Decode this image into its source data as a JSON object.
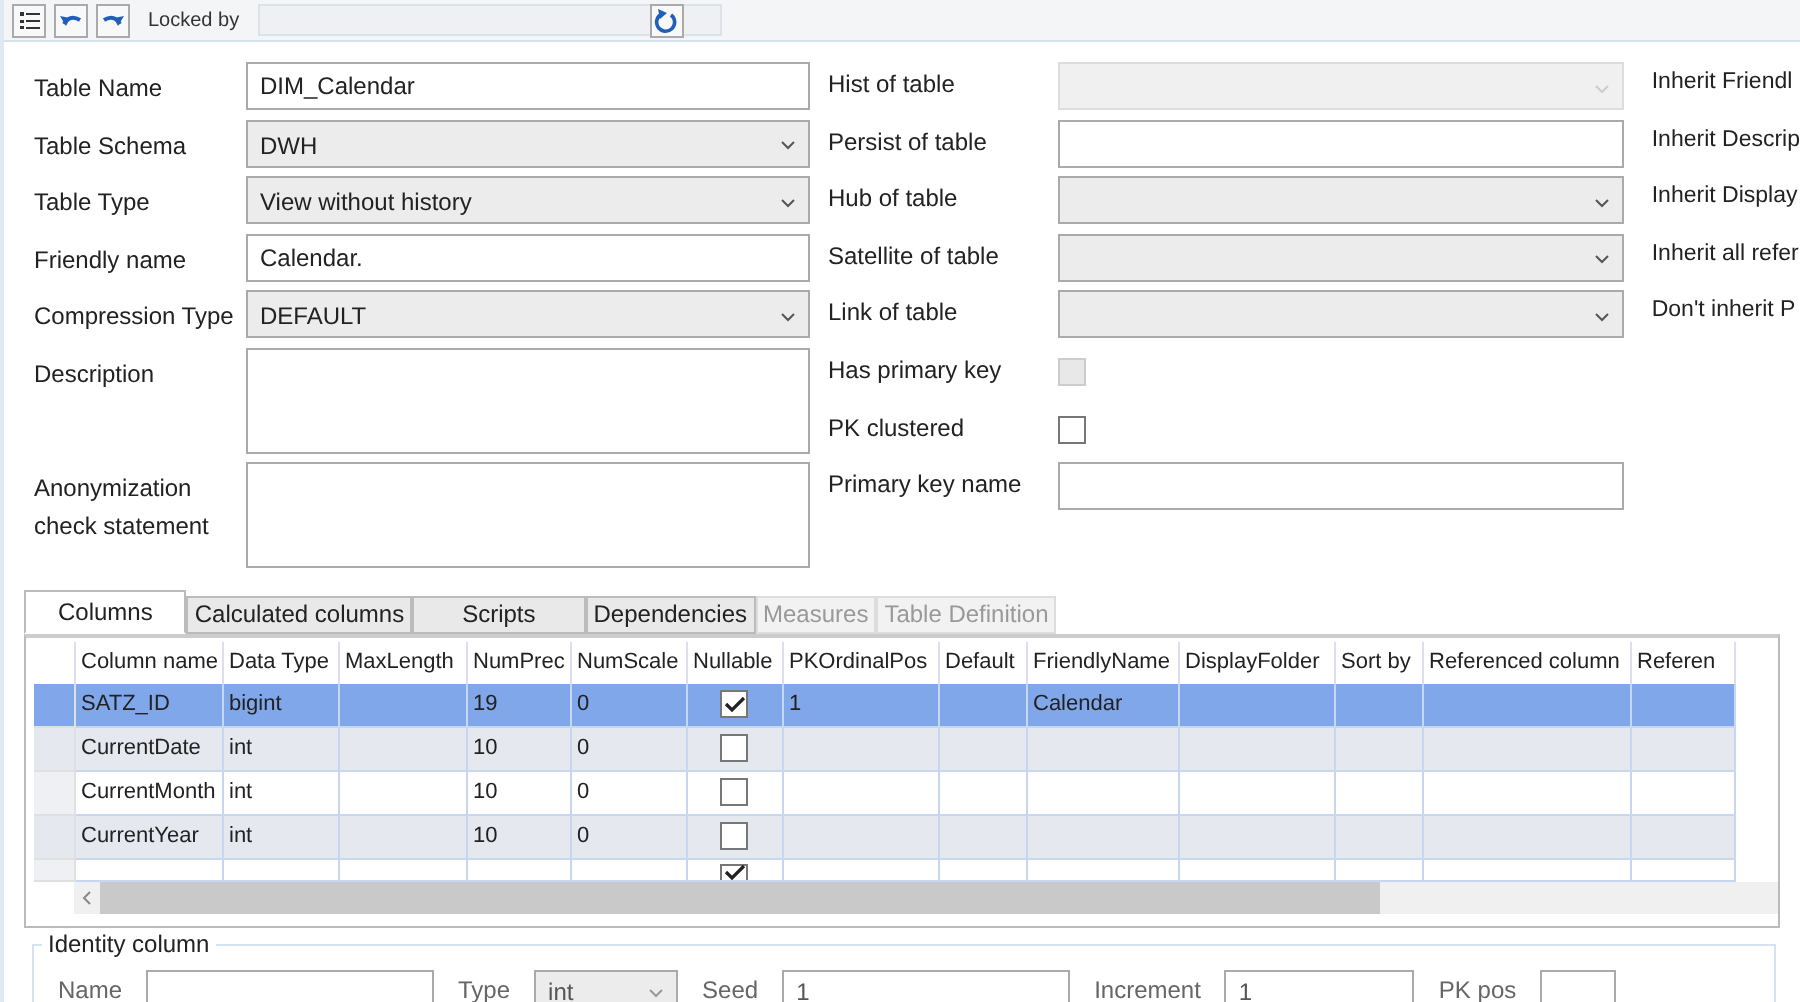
{
  "toolbar": {
    "locked_label": "Locked by"
  },
  "form_left": [
    {
      "label": "Table Name",
      "kind": "text",
      "value": "DIM_Calendar"
    },
    {
      "label": "Table Schema",
      "kind": "select",
      "value": "DWH"
    },
    {
      "label": "Table Type",
      "kind": "select",
      "value": "View without history"
    },
    {
      "label": "Friendly name",
      "kind": "text",
      "value": "Calendar."
    },
    {
      "label": "Compression Type",
      "kind": "select",
      "value": "DEFAULT"
    },
    {
      "label": "Description",
      "kind": "textarea"
    },
    {
      "label": "Anonymization check statement",
      "kind": "textarea"
    }
  ],
  "form_middle": [
    {
      "label": "Hist of table",
      "kind": "select",
      "disabled": true
    },
    {
      "label": "Persist of table",
      "kind": "text",
      "disabled": false
    },
    {
      "label": "Hub of table",
      "kind": "select",
      "disabled": false
    },
    {
      "label": "Satellite of table",
      "kind": "select",
      "disabled": false
    },
    {
      "label": "Link of table",
      "kind": "select",
      "disabled": false
    },
    {
      "label": "Has primary key",
      "kind": "checkbox",
      "checked": false,
      "disabled": true
    },
    {
      "label": "PK clustered",
      "kind": "checkbox",
      "checked": false,
      "disabled": false
    },
    {
      "label": "Primary key name",
      "kind": "text",
      "disabled": false
    }
  ],
  "form_right": [
    "Inherit Friendl",
    "Inherit Descrip",
    "Inherit Display",
    "Inherit all refer",
    "Don't inherit P"
  ],
  "tabs": [
    {
      "label": "Columns",
      "selected": true,
      "disabled": false
    },
    {
      "label": "Calculated columns",
      "selected": false,
      "disabled": false
    },
    {
      "label": "Scripts",
      "selected": false,
      "disabled": false
    },
    {
      "label": "Dependencies",
      "selected": false,
      "disabled": false
    },
    {
      "label": "Measures",
      "selected": false,
      "disabled": true
    },
    {
      "label": "Table Definition",
      "selected": false,
      "disabled": true
    }
  ],
  "table": {
    "columns": [
      "Column name",
      "Data Type",
      "MaxLength",
      "NumPrec",
      "NumScale",
      "Nullable",
      "PKOrdinalPos",
      "Default",
      "FriendlyName",
      "DisplayFolder",
      "Sort by",
      "Referenced column",
      "Referen"
    ],
    "rows": [
      {
        "selected": true,
        "cells": [
          "SATZ_ID",
          "bigint",
          "",
          "19",
          "0",
          "",
          "1",
          "",
          "Calendar",
          "",
          "",
          "",
          ""
        ],
        "nullable": true
      },
      {
        "selected": false,
        "cells": [
          "CurrentDate",
          "int",
          "",
          "10",
          "0",
          "",
          "",
          "",
          "",
          "",
          "",
          "",
          ""
        ],
        "nullable": false
      },
      {
        "selected": false,
        "cells": [
          "CurrentMonth",
          "int",
          "",
          "10",
          "0",
          "",
          "",
          "",
          "",
          "",
          "",
          "",
          ""
        ],
        "nullable": false
      },
      {
        "selected": false,
        "cells": [
          "CurrentYear",
          "int",
          "",
          "10",
          "0",
          "",
          "",
          "",
          "",
          "",
          "",
          "",
          ""
        ],
        "nullable": false
      },
      {
        "selected": false,
        "cells": [
          "",
          "",
          "",
          "",
          "",
          "",
          "",
          "",
          "",
          "",
          "",
          "",
          ""
        ],
        "nullable": true
      }
    ]
  },
  "identity": {
    "title": "Identity column",
    "name_label": "Name",
    "type_label": "Type",
    "type_value": "int",
    "seed_label": "Seed",
    "seed_value": "1",
    "increment_label": "Increment",
    "increment_value": "1",
    "pk_pos_label": "PK pos"
  }
}
